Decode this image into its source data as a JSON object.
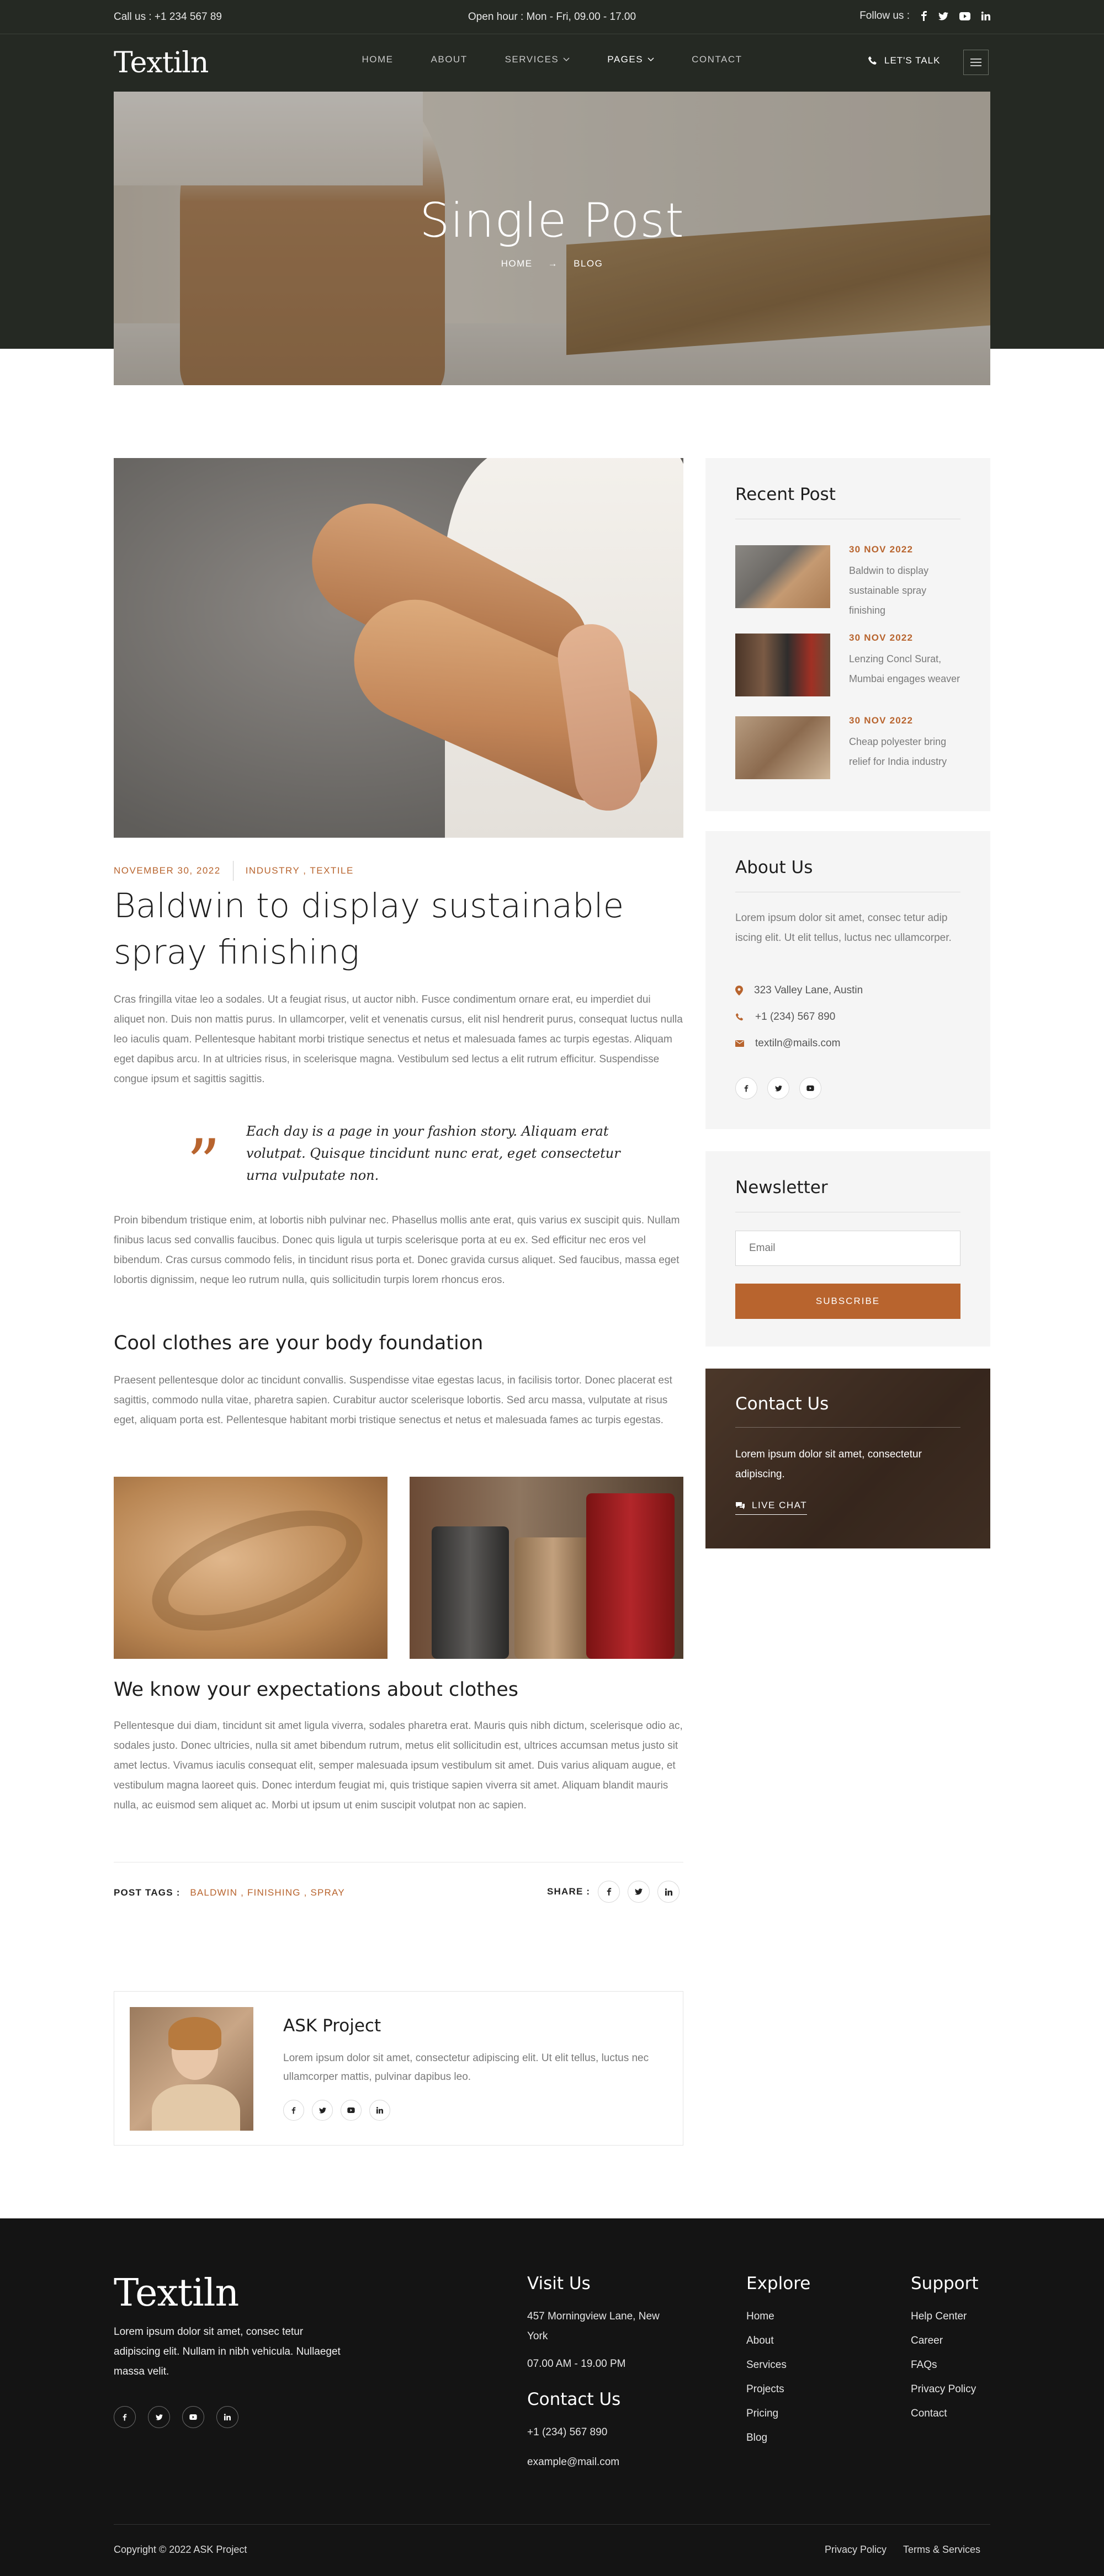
{
  "topbar": {
    "phone": "Call us : +1 234 567 89",
    "hours": "Open hour : Mon - Fri, 09.00 - 17.00",
    "follow": "Follow us :"
  },
  "header": {
    "logo": "Textiln",
    "nav": [
      {
        "label": "HOME"
      },
      {
        "label": "ABOUT"
      },
      {
        "label": "SERVICES"
      },
      {
        "label": "PAGES"
      },
      {
        "label": "CONTACT"
      }
    ],
    "talk": "LET'S TALK"
  },
  "hero": {
    "title": "Single Post",
    "crumb_home": "HOME",
    "crumb_current": "BLOG"
  },
  "post": {
    "date": "NOVEMBER 30, 2022",
    "categories": "INDUSTRY , TEXTILE",
    "title": "Baldwin to display sustainable spray finishing",
    "para1": "Cras fringilla vitae leo a sodales. Ut a feugiat risus, ut auctor nibh. Fusce condimentum ornare erat, eu imperdiet dui aliquet non. Duis non mattis purus. In ullamcorper, velit et venenatis cursus, elit nisl hendrerit purus, consequat luctus nulla leo iaculis quam. Pellentesque habitant morbi tristique senectus et netus et malesuada fames ac turpis egestas. Aliquam eget dapibus arcu. In at ultricies risus, in scelerisque magna. Vestibulum sed lectus a elit rutrum efficitur. Suspendisse congue ipsum et sagittis sagittis.",
    "quote": "Each day is a page in your fashion story. Aliquam erat volutpat. Quisque tincidunt nunc erat, eget consectetur urna vulputate non.",
    "para2": "Proin bibendum tristique enim, at lobortis nibh pulvinar nec. Phasellus mollis ante erat, quis varius ex suscipit quis. Nullam finibus lacus sed convallis faucibus. Donec quis ligula ut turpis scelerisque porta at eu ex. Sed efficitur nec eros vel bibendum. Cras cursus commodo felis, in tincidunt risus porta et. Donec gravida cursus aliquet. Sed faucibus, massa eget lobortis dignissim, neque leo rutrum nulla, quis sollicitudin turpis lorem rhoncus eros.",
    "heading2": "Cool clothes are your body foundation",
    "para3": "Praesent pellentesque dolor ac tincidunt convallis. Suspendisse vitae egestas lacus, in facilisis tortor. Donec placerat est sagittis, commodo nulla vitae, pharetra sapien. Curabitur auctor scelerisque lobortis. Sed arcu massa, vulputate at risus eget, aliquam porta est. Pellentesque habitant morbi tristique senectus et netus et malesuada fames ac turpis egestas.",
    "heading3": "We know your expectations about clothes",
    "para4": "Pellentesque dui diam, tincidunt sit amet ligula viverra, sodales pharetra erat. Mauris quis nibh dictum, scelerisque odio ac, sodales justo. Donec ultricies, nulla sit amet bibendum rutrum, metus elit sollicitudin est, ultrices accumsan metus justo sit amet lectus. Vivamus iaculis consequat elit, semper malesuada ipsum vestibulum sit amet. Duis varius aliquam augue, et vestibulum magna laoreet quis. Donec interdum feugiat mi, quis tristique sapien viverra sit amet. Aliquam blandit mauris nulla, ac euismod sem aliquet ac. Morbi ut ipsum ut enim suscipit volutpat non ac sapien.",
    "tags_label": "POST TAGS :",
    "tags": "BALDWIN , FINISHING , SPRAY",
    "share_label": "SHARE :"
  },
  "author": {
    "name": "ASK Project",
    "bio": "Lorem ipsum dolor sit amet, consectetur adipiscing elit. Ut elit tellus, luctus nec ullamcorper mattis, pulvinar dapibus leo."
  },
  "sidebar": {
    "recent_title": "Recent Post",
    "recent": [
      {
        "date": "30 NOV 2022",
        "title": "Baldwin to display sustainable spray finishing"
      },
      {
        "date": "30 NOV 2022",
        "title": "Lenzing Concl Surat, Mumbai engages weaver"
      },
      {
        "date": "30 NOV 2022",
        "title": "Cheap polyester bring relief for India industry"
      }
    ],
    "about_title": "About Us",
    "about_text": "Lorem ipsum dolor sit amet, consec tetur adip iscing elit. Ut elit tellus, luctus nec ullamcorper.",
    "address": "323 Valley Lane, Austin",
    "phone": "+1 (234) 567 890",
    "email": "textiln@mails.com",
    "newsletter_title": "Newsletter",
    "email_placeholder": "Email",
    "subscribe": "SUBSCRIBE",
    "contact_title": "Contact Us",
    "contact_text": "Lorem ipsum dolor sit amet, consectetur adipiscing.",
    "live_chat": "LIVE CHAT"
  },
  "footer": {
    "logo": "Textiln",
    "text": "Lorem ipsum dolor sit amet, consec tetur adipiscing elit. Nullam in nibh vehicula. Nullaeget massa velit.",
    "visit_title": "Visit Us",
    "visit_address": "457 Morningview Lane, New York",
    "visit_hours": "07.00 AM - 19.00 PM",
    "contact_title": "Contact Us",
    "contact_phone": "+1 (234) 567 890",
    "contact_email": "example@mail.com",
    "explore_title": "Explore",
    "explore": [
      "Home",
      "About",
      "Services",
      "Projects",
      "Pricing",
      "Blog"
    ],
    "support_title": "Support",
    "support": [
      "Help Center",
      "Career",
      "FAQs",
      "Privacy Policy",
      "Contact"
    ],
    "copyright": "Copyright © 2022 ASK Project",
    "privacy": "Privacy Policy",
    "terms": "Terms & Services"
  },
  "colors": {
    "accent": "#b8642e",
    "dark": "#252923",
    "footer": "#141414"
  }
}
